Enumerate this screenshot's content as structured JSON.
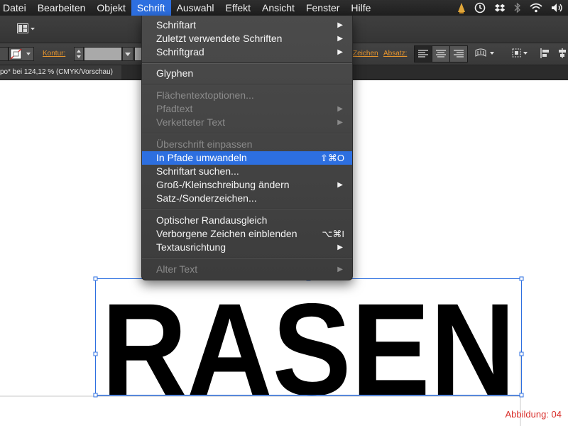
{
  "menubar": {
    "items": [
      "Datei",
      "Bearbeiten",
      "Objekt",
      "Schrift",
      "Auswahl",
      "Effekt",
      "Ansicht",
      "Fenster",
      "Hilfe"
    ],
    "active_index": 3,
    "status_icons": [
      "adobe-icon",
      "timemachine-icon",
      "dropbox-icon",
      "bluetooth-icon",
      "wifi-icon",
      "volume-icon"
    ]
  },
  "controlbar": {
    "kontur_label": "Kontur:",
    "zeichen_label": "Zeichen",
    "absatz_label": "Absatz:"
  },
  "document": {
    "tab_title": "po* bei 124,12 % (CMYK/Vorschau)"
  },
  "menu": {
    "groups": [
      [
        {
          "label": "Schriftart",
          "submenu": true,
          "enabled": true
        },
        {
          "label": "Zuletzt verwendete Schriften",
          "submenu": true,
          "enabled": true
        },
        {
          "label": "Schriftgrad",
          "submenu": true,
          "enabled": true
        }
      ],
      [
        {
          "label": "Glyphen",
          "submenu": false,
          "enabled": true
        }
      ],
      [
        {
          "label": "Flächentextoptionen...",
          "submenu": false,
          "enabled": false
        },
        {
          "label": "Pfadtext",
          "submenu": true,
          "enabled": false
        },
        {
          "label": "Verketteter Text",
          "submenu": true,
          "enabled": false
        }
      ],
      [
        {
          "label": "Überschrift einpassen",
          "submenu": false,
          "enabled": false
        },
        {
          "label": "In Pfade umwandeln",
          "shortcut": "⇧⌘O",
          "submenu": false,
          "enabled": true,
          "highlighted": true
        },
        {
          "label": "Schriftart suchen...",
          "submenu": false,
          "enabled": true
        },
        {
          "label": "Groß-/Kleinschreibung ändern",
          "submenu": true,
          "enabled": true
        },
        {
          "label": "Satz-/Sonderzeichen...",
          "submenu": false,
          "enabled": true
        }
      ],
      [
        {
          "label": "Optischer Randausgleich",
          "submenu": false,
          "enabled": true
        },
        {
          "label": "Verborgene Zeichen einblenden",
          "shortcut": "⌥⌘I",
          "submenu": false,
          "enabled": true
        },
        {
          "label": "Textausrichtung",
          "submenu": true,
          "enabled": true
        }
      ],
      [
        {
          "label": "Alter Text",
          "submenu": true,
          "enabled": false
        }
      ]
    ]
  },
  "artboard": {
    "text": "RASEN",
    "caption": "Abbildung: 04"
  },
  "colors": {
    "highlight": "#2d6fe0",
    "selection": "#2d6fe0",
    "caption": "#d9302c",
    "control_label": "#e8962e"
  }
}
